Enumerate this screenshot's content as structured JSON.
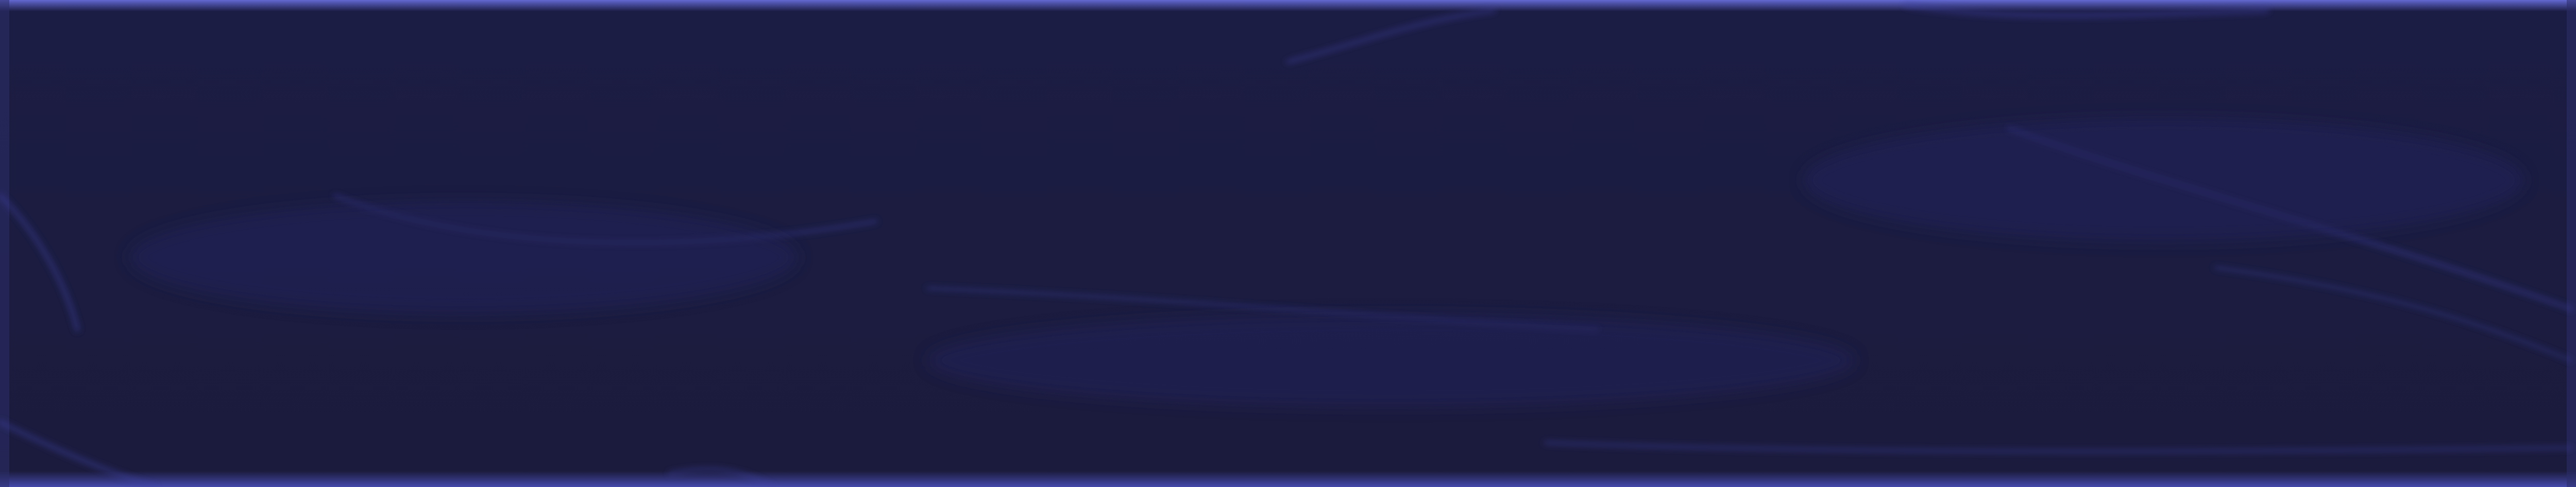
{
  "surface": {
    "kind": "glossy-tile",
    "base_color": "#1b1c40",
    "highlight_color": "#5a5fd0",
    "edge_color": "#4a4fb8"
  }
}
